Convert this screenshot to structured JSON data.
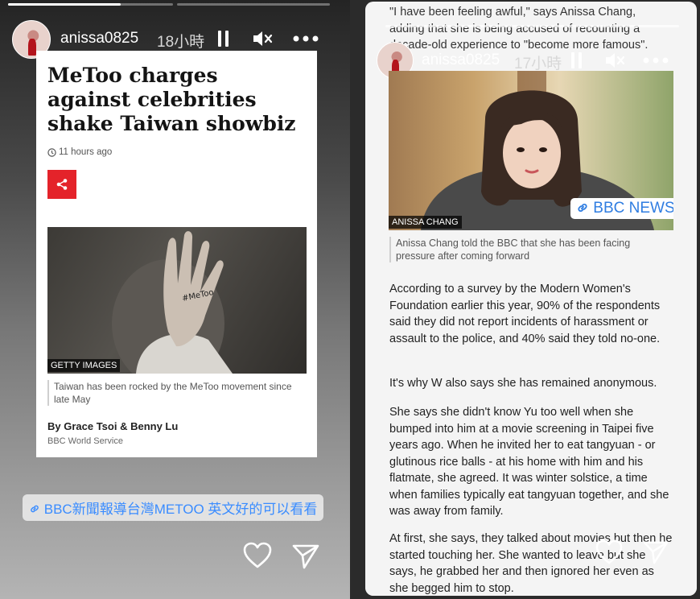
{
  "left_story": {
    "username": "anissa0825",
    "time_ago": "18小時",
    "progress_fraction": 0.37,
    "article": {
      "headline": "MeToo charges against celebrities shake Taiwan showbiz",
      "timestamp": "11 hours ago",
      "image_credit": "GETTY IMAGES",
      "hand_text": "#MeToo",
      "image_caption": "Taiwan has been rocked by the MeToo movement since late May",
      "byline": "By Grace Tsoi & Benny Lu",
      "byline_org": "BBC World Service"
    },
    "link_sticker_text": "BBC新聞報導台灣METOO 英文好的可以看看"
  },
  "right_story": {
    "username": "anissa0825",
    "time_ago": "17小時",
    "top_quote": "\"I have been feeling awful,\" says Anissa Chang, adding that she is being accused of recounting a decade-old experience to \"become more famous\".",
    "photo_credit": "ANISSA CHANG",
    "sticker_text": "BBC NEWS",
    "photo_caption": "Anissa Chang told the BBC that she has been facing pressure after coming forward",
    "paragraphs": [
      "According to a survey by the Modern Women's Foundation earlier this year, 90% of the respondents said they did not report incidents of harassment or assault to the police, and 40% said they told no-one.",
      "It's why W also says she has remained anonymous.",
      "She says she didn't know Yu too well when she bumped into him at a movie screening in Taipei five years ago. When he invited her to eat tangyuan - or glutinous rice balls - at his home with him and his flatmate, she agreed. It was winter solstice, a time when families typically eat tangyuan together, and she was away from family.",
      "At first, she says, they talked about movies but then he started touching her. She wanted to leave but she says, he grabbed her and then ignored her even as she begged him to stop."
    ]
  },
  "colors": {
    "bbc_red": "#e4232a",
    "link_blue": "#3a8cff"
  },
  "icons": [
    "pause-icon",
    "mute-icon",
    "more-icon",
    "clock-icon",
    "share-icon",
    "link-icon",
    "heart-icon",
    "send-icon"
  ]
}
